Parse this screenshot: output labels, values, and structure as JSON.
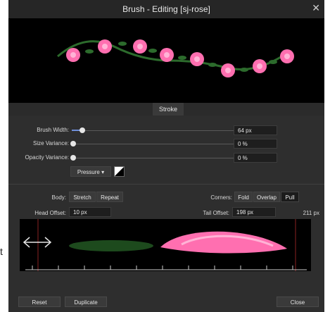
{
  "window": {
    "title": "Brush - Editing [sj-rose]",
    "close_icon": "close-icon"
  },
  "tabs": [
    {
      "label": "Stroke"
    }
  ],
  "controls": {
    "brush_width": {
      "label": "Brush Width:",
      "value": "64 px",
      "level": 0.08
    },
    "size_variance": {
      "label": "Size Variance:",
      "value": "0 %",
      "level": 0.0
    },
    "opacity_variance": {
      "label": "Opacity Variance:",
      "value": "0 %",
      "level": 0.0
    },
    "pressure": {
      "label": "Pressure"
    }
  },
  "body": {
    "label": "Body:",
    "options": [
      "Stretch",
      "Repeat"
    ]
  },
  "corners": {
    "label": "Corners:",
    "options": [
      "Fold",
      "Overlap",
      "Pull"
    ],
    "selected": "Pull"
  },
  "head_offset": {
    "label": "Head Offset:",
    "value": "10 px"
  },
  "tail_offset": {
    "label": "Tail Offset:",
    "value": "198 px"
  },
  "image_width": "211 px",
  "footer": {
    "reset": "Reset",
    "duplicate": "Duplicate",
    "close": "Close"
  },
  "outside_text": "t",
  "colors": {
    "accent": "#6f8fd9",
    "rose": "#ff6fb0",
    "leaf": "#2c6b2c",
    "background": "#2e2e2e"
  }
}
